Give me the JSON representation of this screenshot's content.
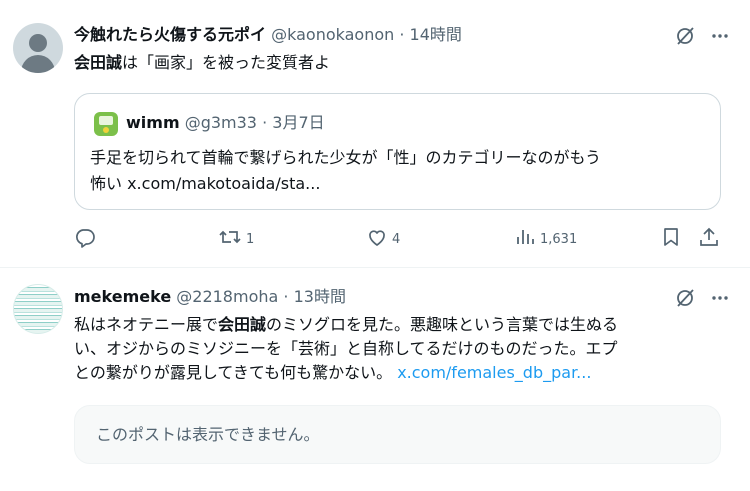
{
  "post1": {
    "display_name": "今触れたら火傷する元ポイ",
    "handle": "@kaonokaonon",
    "separator": "·",
    "time": "14時間",
    "text_bold": "会田誠",
    "text_rest": "は「画家」を被った変質者よ",
    "quote": {
      "display_name": "wimm",
      "handle": "@g3m33",
      "separator": "·",
      "date": "3月7日",
      "text_line1": "手足を切られて首輪で繋げられた少女が「性」のカテゴリーなのがもう",
      "text_line2": "怖い x.com/makotoaida/sta..."
    },
    "actions": {
      "reply_count": "",
      "repost_count": "1",
      "like_count": "4",
      "views_count": "1,631"
    }
  },
  "post2": {
    "display_name": "mekemeke",
    "handle": "@2218moha",
    "separator": "·",
    "time": "13時間",
    "text_part1": "私はネオテニー展で",
    "text_bold": "会田誠",
    "text_part2": "のミソグロを見た。悪趣味という言葉では生ぬる",
    "text_line2": "い、オジからのミソジニーを「芸術」と自称してるだけのものだった。エプ",
    "text_line3": "との繋がりが露見してきても何も驚かない。",
    "link": "x.com/females_db_par...",
    "unavailable_text": "このポストは表示できません。"
  },
  "icons": {
    "grok": "grok-icon",
    "more": "more-icon",
    "reply": "reply-icon",
    "repost": "repost-icon",
    "like": "like-icon",
    "views": "views-icon",
    "bookmark": "bookmark-icon",
    "share": "share-icon"
  },
  "colors": {
    "text": "#0f1419",
    "secondary": "#536471",
    "link": "#1d9bf0",
    "border": "#cfd9de"
  }
}
